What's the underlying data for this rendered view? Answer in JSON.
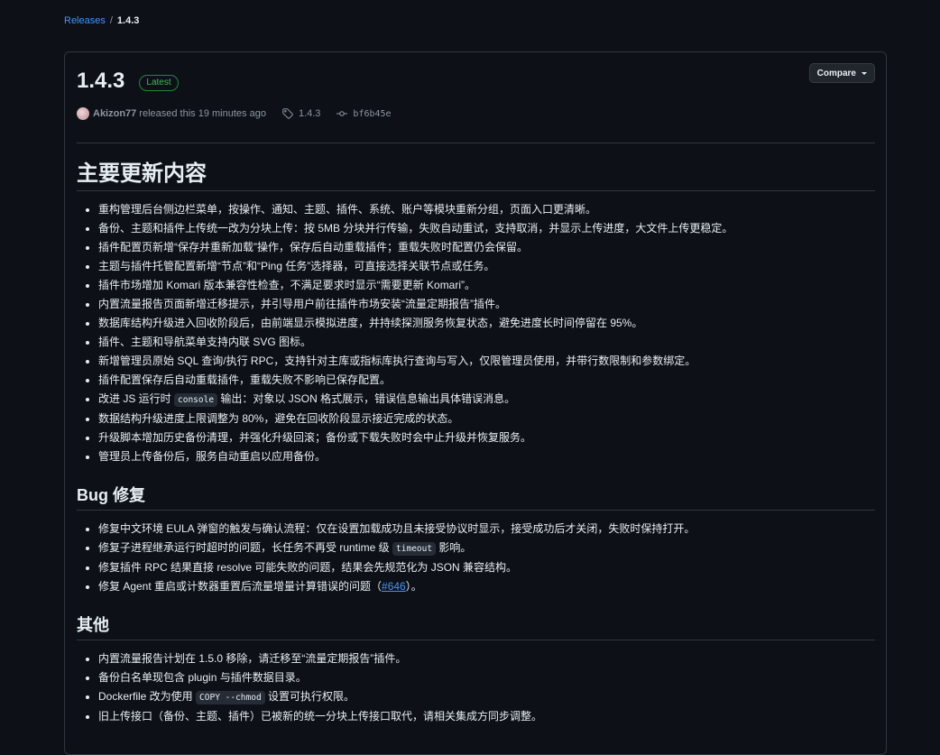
{
  "breadcrumb": {
    "releases_label": "Releases",
    "separator": "/",
    "current": "1.4.3"
  },
  "release": {
    "title": "1.4.3",
    "badge": "Latest",
    "compare_label": "Compare",
    "author": "Akizon77",
    "released_text": "released this 19 minutes ago",
    "tag": "1.4.3",
    "commit": "bf6b45e"
  },
  "sections": {
    "main_title": "主要更新内容",
    "main_items": [
      "重构管理后台侧边栏菜单，按操作、通知、主题、插件、系统、账户等模块重新分组，页面入口更清晰。",
      "备份、主题和插件上传统一改为分块上传：按 5MB 分块并行传输，失败自动重试，支持取消，并显示上传进度，大文件上传更稳定。",
      "插件配置页新增“保存并重新加载”操作，保存后自动重载插件；重载失败时配置仍会保留。",
      "主题与插件托管配置新增“节点”和“Ping 任务”选择器，可直接选择关联节点或任务。",
      "插件市场增加 Komari 版本兼容性检查，不满足要求时显示“需要更新 Komari”。",
      "内置流量报告页面新增迁移提示，并引导用户前往插件市场安装“流量定期报告”插件。",
      "数据库结构升级进入回收阶段后，由前端显示模拟进度，并持续探测服务恢复状态，避免进度长时间停留在 95%。",
      "插件、主题和导航菜单支持内联 SVG 图标。",
      "新增管理员原始 SQL 查询/执行 RPC，支持针对主库或指标库执行查询与写入，仅限管理员使用，并带行数限制和参数绑定。",
      "插件配置保存后自动重载插件，重载失败不影响已保存配置。"
    ],
    "console_pre": "改进 JS 运行时 ",
    "console_code": "console",
    "console_post": " 输出：对象以 JSON 格式展示，错误信息输出具体错误消息。",
    "main_items_tail": [
      "数据结构升级进度上限调整为 80%，避免在回收阶段显示接近完成的状态。",
      "升级脚本增加历史备份清理，并强化升级回滚；备份或下载失败时会中止升级并恢复服务。",
      "管理员上传备份后，服务自动重启以应用备份。"
    ],
    "bug_title": "Bug 修复",
    "bug_item1": "修复中文环境 EULA 弹窗的触发与确认流程：仅在设置加载成功且未接受协议时显示，接受成功后才关闭，失败时保持打开。",
    "bug_item2_pre": "修复子进程继承运行时超时的问题，长任务不再受 runtime 级 ",
    "bug_item2_code": "timeout",
    "bug_item2_post": " 影响。",
    "bug_item3": "修复插件 RPC 结果直接 resolve 可能失败的问题，结果会先规范化为 JSON 兼容结构。",
    "bug_item4_pre": "修复 Agent 重启或计数器重置后流量增量计算错误的问题（",
    "bug_item4_link": "#646",
    "bug_item4_post": "）。",
    "other_title": "其他",
    "other_item1": "内置流量报告计划在 1.5.0 移除，请迁移至“流量定期报告”插件。",
    "other_item2": "备份白名单现包含 plugin 与插件数据目录。",
    "other_item3_pre": "Dockerfile 改为使用 ",
    "other_item3_code": "COPY --chmod",
    "other_item3_post": " 设置可执行权限。",
    "other_item4": "旧上传接口（备份、主题、插件）已被新的统一分块上传接口取代，请相关集成方同步调整。"
  },
  "colors": {
    "background": "#0d1117",
    "link": "#4493f8",
    "badge": "#3fb950",
    "border": "#30363d"
  },
  "icons": [
    "tag-icon",
    "commit-icon",
    "caret-down-icon",
    "avatar"
  ]
}
